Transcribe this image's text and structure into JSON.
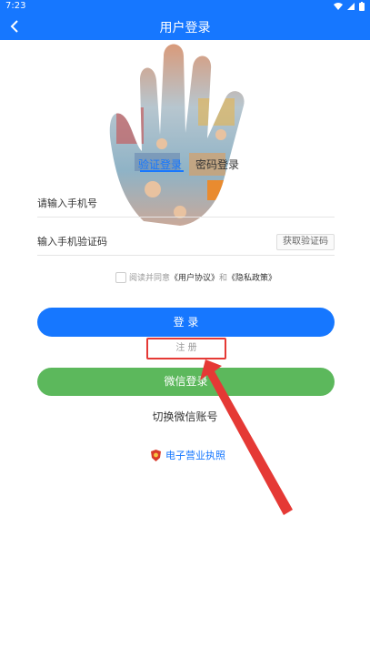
{
  "statusbar": {
    "time": "7:23"
  },
  "header": {
    "title": "用户登录"
  },
  "tabs": {
    "active": "验证登录",
    "inactive": "密码登录"
  },
  "phone": {
    "placeholder": "请输入手机号"
  },
  "code": {
    "placeholder": "输入手机验证码",
    "button": "获取验证码"
  },
  "agreement": {
    "prefix": "阅读并同意",
    "user": "《用户协议》",
    "and": "和",
    "privacy": "《隐私政策》"
  },
  "buttons": {
    "login": "登 录",
    "register": "注 册",
    "wechat": "微信登录"
  },
  "switch_wechat": "切换微信账号",
  "license": "电子营业执照",
  "colors": {
    "primary": "#1677ff",
    "wechat": "#5cb85c",
    "highlight": "#e53935"
  }
}
